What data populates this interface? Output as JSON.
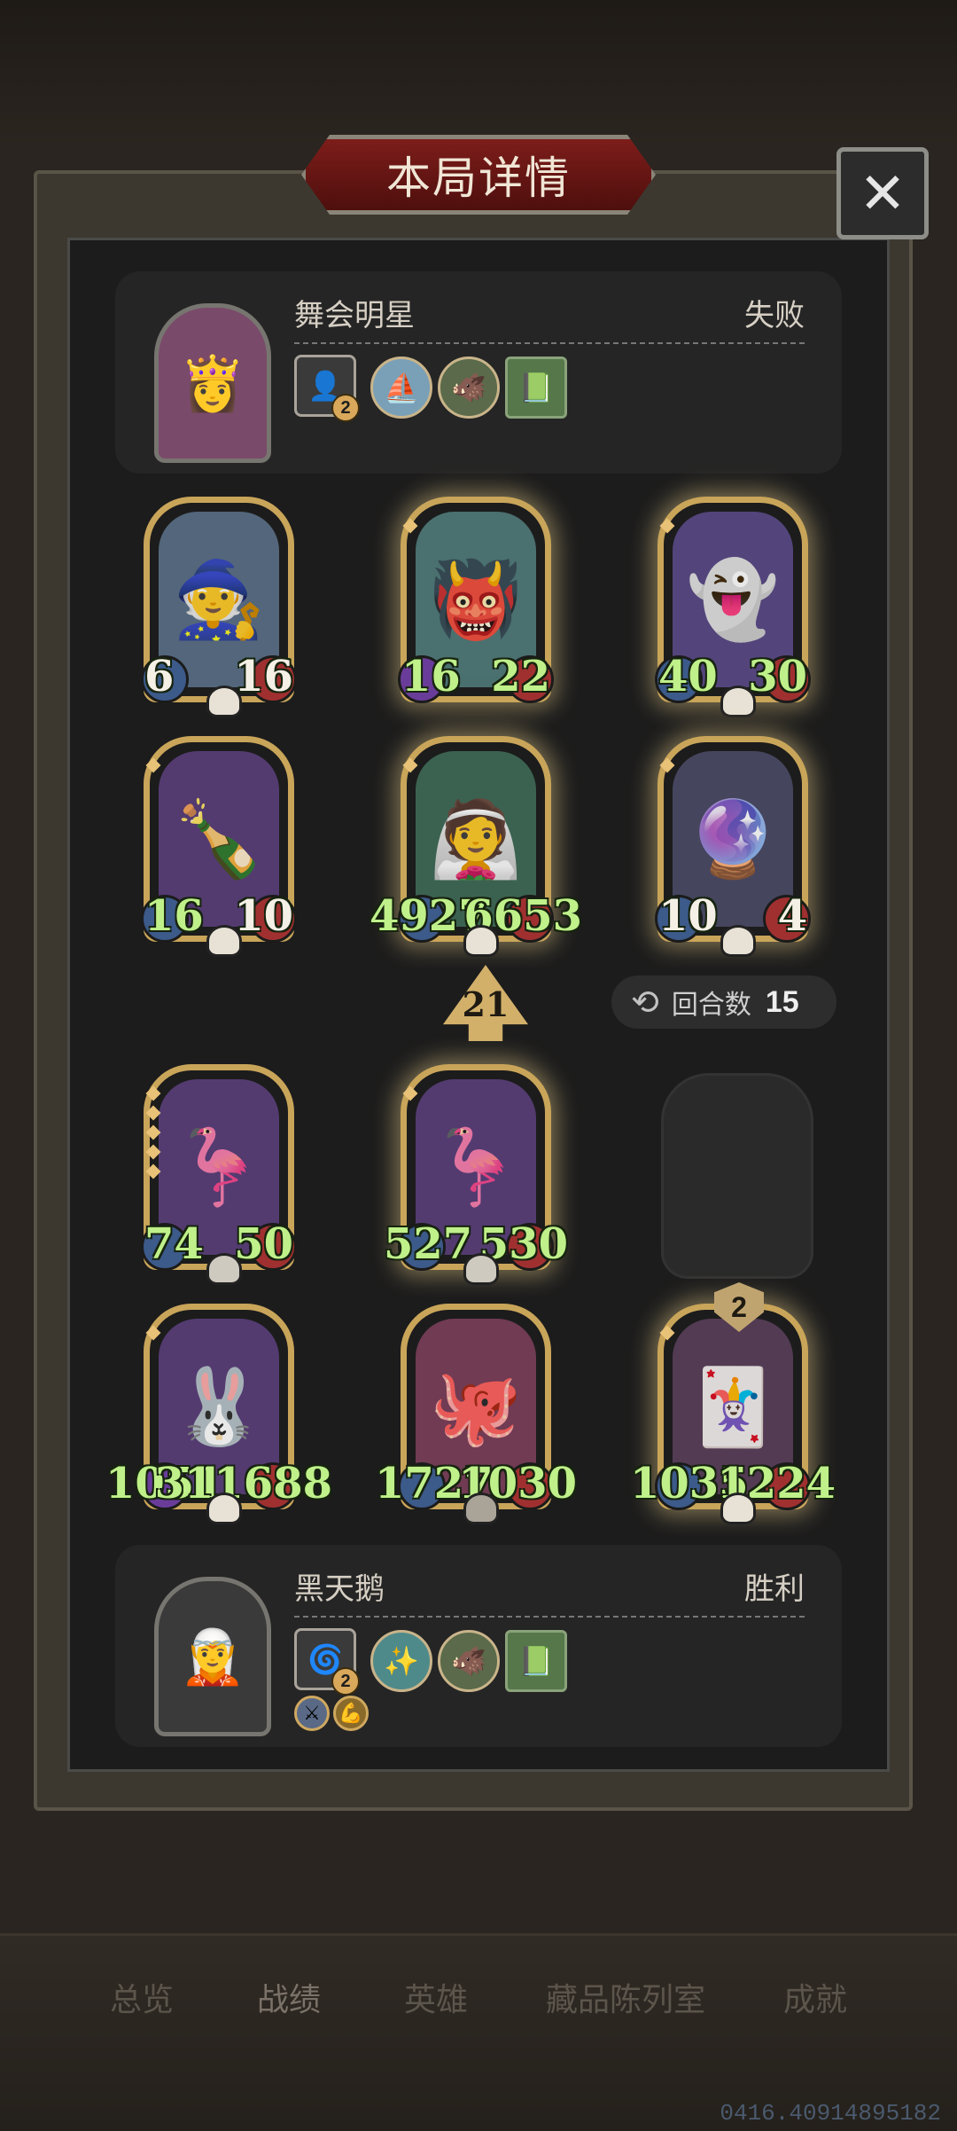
{
  "dialog": {
    "title": "本局详情",
    "close_label": "✕"
  },
  "top_player": {
    "name": "舞会明星",
    "result": "失败",
    "relic_level": "2"
  },
  "bottom_player": {
    "name": "黑天鹅",
    "result": "胜利",
    "relic_level": "2"
  },
  "top_board": [
    {
      "atk": "6",
      "hp": "16"
    },
    {
      "atk": "16",
      "hp": "22"
    },
    {
      "atk": "40",
      "hp": "30"
    },
    {
      "atk": "16",
      "hp": "10"
    },
    {
      "atk": "4927",
      "hp": "6653"
    },
    {
      "atk": "10",
      "hp": "4"
    }
  ],
  "bottom_board": [
    {
      "atk": "74",
      "hp": "50"
    },
    {
      "atk": "527",
      "hp": "530"
    },
    {
      "atk": "1051",
      "hp": "311688"
    },
    {
      "atk": "1727",
      "hp": "1030"
    },
    {
      "atk": "1035",
      "hp": "1224"
    }
  ],
  "attack_count": "21",
  "turns": {
    "label": "回合数",
    "value": "15"
  },
  "minion_shield": "2",
  "tabs": [
    "总览",
    "战绩",
    "英雄",
    "藏品陈列室",
    "成就"
  ],
  "version": "0416.40914895182",
  "colors": {
    "accent": "#c9a55a",
    "title_red": "#7d1d1a",
    "stat_green": "#bff08a"
  }
}
